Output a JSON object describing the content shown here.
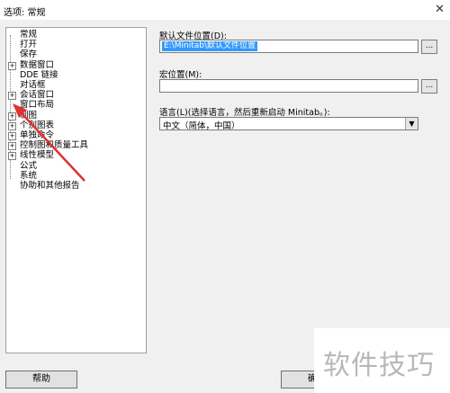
{
  "window": {
    "title": "选项: 常规",
    "close_glyph": "✕"
  },
  "tree": {
    "items": [
      {
        "label": "常规",
        "expandable": false
      },
      {
        "label": "打开",
        "expandable": false
      },
      {
        "label": "保存",
        "expandable": false
      },
      {
        "label": "数据窗口",
        "expandable": true
      },
      {
        "label": "DDE 链接",
        "expandable": false
      },
      {
        "label": "对话框",
        "expandable": false
      },
      {
        "label": "会话窗口",
        "expandable": true
      },
      {
        "label": "窗口布局",
        "expandable": false
      },
      {
        "label": "制图",
        "expandable": true
      },
      {
        "label": "个别图表",
        "expandable": true
      },
      {
        "label": "单独命令",
        "expandable": true
      },
      {
        "label": "控制图和质量工具",
        "expandable": true
      },
      {
        "label": "线性模型",
        "expandable": true
      },
      {
        "label": "公式",
        "expandable": false
      },
      {
        "label": "系统",
        "expandable": false
      },
      {
        "label": "协助和其他报告",
        "expandable": false
      }
    ],
    "expander_glyph": "+"
  },
  "default_file_location": {
    "label": "默认文件位置(D):",
    "value": "E:\\Minitab\\默认文件位置",
    "browse_label": "..."
  },
  "macro_location": {
    "label": "宏位置(M):",
    "value": "",
    "browse_label": "..."
  },
  "language": {
    "label": "语言(L)(选择语言，然后重新启动 Minitab。):",
    "selected": "中文（简体，中国）",
    "arrow_glyph": "▼"
  },
  "buttons": {
    "help": "帮助",
    "ok": "确定"
  },
  "watermark": {
    "text": "软件技巧"
  },
  "colors": {
    "selection": "#3399ff",
    "annotation_arrow": "#e03030"
  }
}
